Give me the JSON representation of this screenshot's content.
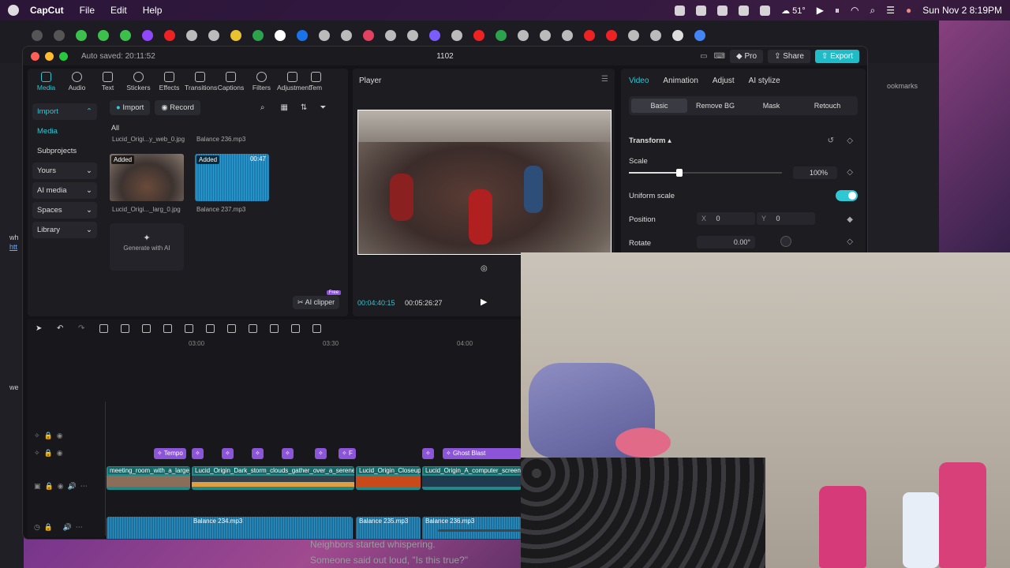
{
  "menubar": {
    "app": "CapCut",
    "items": [
      "File",
      "Edit",
      "Help"
    ],
    "battery": "51",
    "datetime": "Sun Nov 2  8:19PM"
  },
  "capcut": {
    "autosave": "Auto saved: 20:11:52",
    "project": "1102",
    "pro": "Pro",
    "share": "Share",
    "export": "Export"
  },
  "toolbar": [
    "Media",
    "Audio",
    "Text",
    "Stickers",
    "Effects",
    "Transitions",
    "Captions",
    "Filters",
    "Adjustment",
    "Tem"
  ],
  "media": {
    "nav": {
      "import": "Import",
      "media": "Media",
      "subprojects": "Subprojects",
      "yours": "Yours",
      "ai_media": "AI media",
      "spaces": "Spaces",
      "library": "Library"
    },
    "import_btn": "Import",
    "record_btn": "Record",
    "filter_all": "All",
    "items": [
      {
        "name": "Lucid_Origi...y_web_0.jpg"
      },
      {
        "name": "Balance 236.mp3"
      },
      {
        "name": "Lucid_Origi..._larg_0.jpg",
        "badge": "Added"
      },
      {
        "name": "Balance 237.mp3",
        "badge": "Added",
        "duration": "00:47"
      }
    ],
    "generate": "Generate with AI",
    "ai_clipper": "AI clipper",
    "free": "Free"
  },
  "player": {
    "title": "Player",
    "current": "00:04:40:15",
    "total": "00:05:26:27"
  },
  "props": {
    "tabs": [
      "Video",
      "Animation",
      "Adjust",
      "AI stylize"
    ],
    "subtabs": [
      "Basic",
      "Remove BG",
      "Mask",
      "Retouch"
    ],
    "transform": "Transform",
    "scale_label": "Scale",
    "scale_value": "100%",
    "scale_level": 0.33,
    "uniform": "Uniform scale",
    "position_label": "Position",
    "pos_x_label": "X",
    "pos_x": "0",
    "pos_y_label": "Y",
    "pos_y": "0",
    "rotate_label": "Rotate",
    "rotate_value": "0.00°"
  },
  "timeline": {
    "ruler": [
      "03:00",
      "03:30",
      "04:00"
    ],
    "effects": [
      "Tempo",
      "F",
      "Ghost Blast"
    ],
    "video_clips": [
      "meeting_room_with_a_large_w",
      "Lucid_Origin_Dark_storm_clouds_gather_over_a_serene_su",
      "Lucid_Origin_Closeup_",
      "Lucid_Origin_A_computer_screen_c"
    ],
    "audio_clips": [
      "Balance 234.mp3",
      "Balance 235.mp3",
      "Balance 236.mp3"
    ]
  },
  "subtitles": [
    "Neighbors started whispering.",
    "Someone said out loud, \"Is this true?\""
  ],
  "side": {
    "bookmarks": "ookmarks",
    "left_frag1": "wh",
    "left_frag2": "htt",
    "left_frag3": "we"
  },
  "colors": {
    "accent": "#2ec8d4",
    "effect": "#8c54d8",
    "audio": "#1e6f9a"
  }
}
